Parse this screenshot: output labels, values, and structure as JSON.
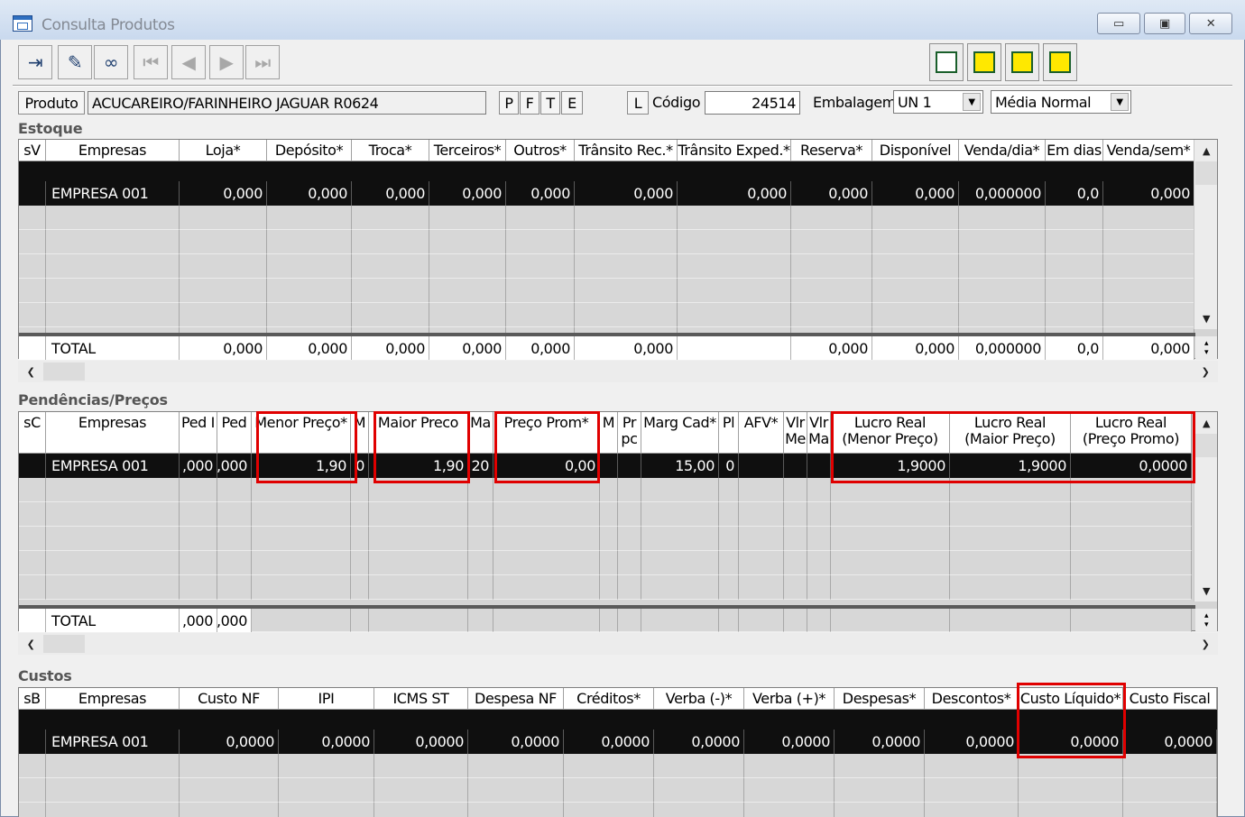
{
  "window": {
    "title": "Consulta Produtos",
    "controls": [
      "▭",
      "▣",
      "✕"
    ]
  },
  "toolbar": {
    "buttons": [
      "exit-icon",
      "eraser-icon",
      "binoculars-icon",
      "first-icon",
      "prev-icon",
      "next-icon",
      "last-icon"
    ],
    "view_buttons": [
      "view-list-icon",
      "view-layout-1-icon",
      "view-layout-2-icon",
      "view-layout-3-icon"
    ]
  },
  "product_bar": {
    "produto_btn": "Produto",
    "produto_value": "ACUCAREIRO/FARINHEIRO JAGUAR R0624",
    "flags": [
      "P",
      "F",
      "T",
      "E"
    ],
    "l_btn": "L",
    "codigo_label": "Código",
    "codigo_value": "24514",
    "embalagem_label": "Embalagem",
    "embalagem_value": "UN  1",
    "media_value": "Média Normal"
  },
  "estoque": {
    "title": "Estoque",
    "corner": "sV",
    "columns": [
      "Empresas",
      "Loja*",
      "Depósito*",
      "Troca*",
      "Terceiros*",
      "Outros*",
      "Trânsito Rec.*",
      "Trânsito Exped.*",
      "Reserva*",
      "Disponível",
      "Venda/dia*",
      "Em dias",
      "Venda/sem*"
    ],
    "row": [
      "EMPRESA 001",
      "0,000",
      "0,000",
      "0,000",
      "0,000",
      "0,000",
      "0,000",
      "0,000",
      "0,000",
      "0,000",
      "0,000000",
      "0,0",
      "0,000"
    ],
    "total": [
      "TOTAL",
      "0,000",
      "0,000",
      "0,000",
      "0,000",
      "0,000",
      "0,000",
      "",
      "0,000",
      "0,000",
      "0,000000",
      "0,0",
      "0,000"
    ]
  },
  "pendencias": {
    "title": "Pendências/Preços",
    "corner": "sC",
    "columns": [
      "Empresas",
      "Ped I",
      "Ped",
      "Menor Preço*",
      "M",
      "Maior Preco",
      "Ma",
      "Preço Prom*",
      "M",
      "Pr\npc",
      "Marg Cad*",
      "Pl",
      "AFV*",
      "Vlr\nMe",
      "Vlr\nMa",
      "Lucro Real\n(Menor Preço)",
      "Lucro Real\n(Maior Preço)",
      "Lucro Real\n(Preço Promo)"
    ],
    "row": [
      "EMPRESA 001",
      ",000",
      ",000",
      "1,90",
      "0",
      "1,90",
      "20",
      "0,00",
      "",
      "",
      "15,00",
      "0",
      "",
      "",
      "",
      "1,9000",
      "1,9000",
      "0,0000"
    ],
    "total": [
      "TOTAL",
      ",000",
      ",000"
    ]
  },
  "custos": {
    "title": "Custos",
    "corner": "sB",
    "columns": [
      "Empresas",
      "Custo NF",
      "IPI",
      "ICMS ST",
      "Despesa NF",
      "Créditos*",
      "Verba (-)*",
      "Verba (+)*",
      "Despesas*",
      "Descontos*",
      "Custo Líquido*",
      "Custo Fiscal"
    ],
    "row": [
      "EMPRESA 001",
      "0,0000",
      "0,0000",
      "0,0000",
      "0,0000",
      "0,0000",
      "0,0000",
      "0,0000",
      "0,0000",
      "0,0000",
      "0,0000",
      "0,0000"
    ]
  }
}
